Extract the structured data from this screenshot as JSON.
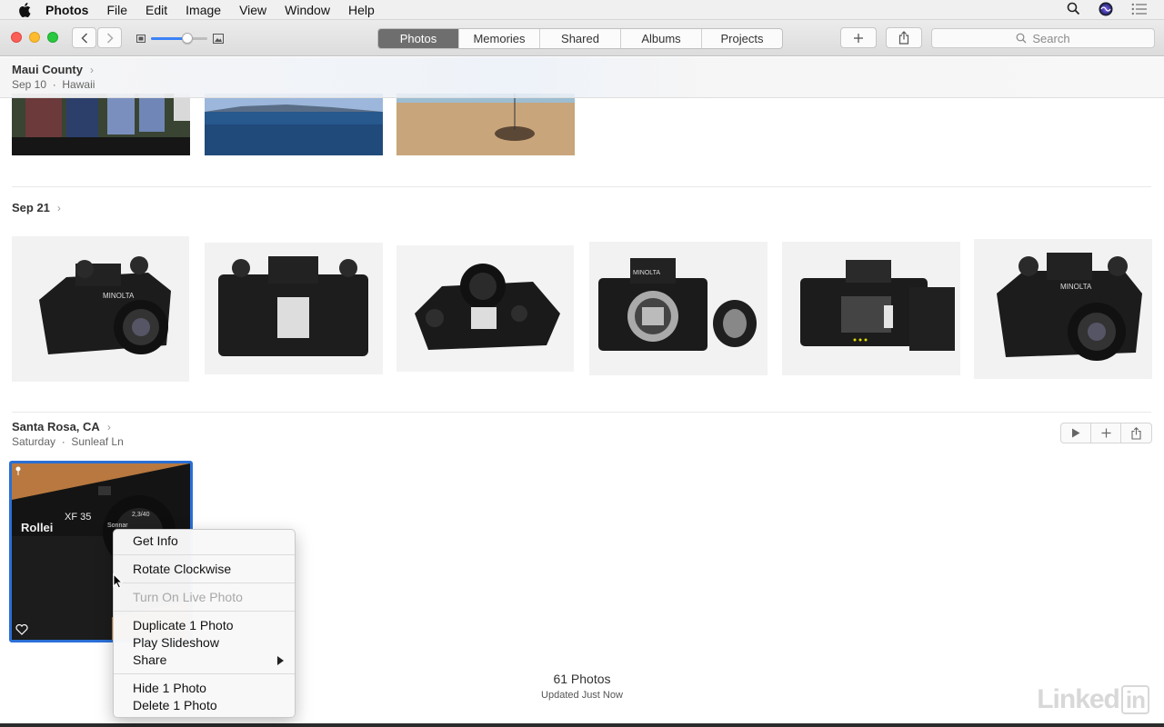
{
  "menubar": {
    "app_name": "Photos",
    "items": [
      "File",
      "Edit",
      "Image",
      "View",
      "Window",
      "Help"
    ],
    "icons": [
      "apple-icon",
      "search-icon",
      "siri-icon",
      "notification-list-icon"
    ]
  },
  "toolbar": {
    "tabs": [
      {
        "label": "Photos",
        "active": true
      },
      {
        "label": "Memories",
        "active": false
      },
      {
        "label": "Shared",
        "active": false
      },
      {
        "label": "Albums",
        "active": false
      },
      {
        "label": "Projects",
        "active": false
      }
    ],
    "zoom_level": 0.65,
    "add_icon": "plus-icon",
    "share_icon": "share-icon",
    "search_placeholder": "Search"
  },
  "sections": [
    {
      "title": "Maui County",
      "subtitle_date": "Sep 10",
      "subtitle_place": "Hawaii"
    },
    {
      "title": "Sep 21"
    },
    {
      "title": "Santa Rosa, CA",
      "subtitle_date": "Saturday",
      "subtitle_place": "Sunleaf Ln"
    }
  ],
  "context_menu": {
    "group1": [
      "Get Info"
    ],
    "group2": [
      "Rotate Clockwise"
    ],
    "group3_disabled": [
      "Turn On Live Photo"
    ],
    "group4": [
      "Duplicate 1 Photo",
      "Play Slideshow",
      "Share"
    ],
    "group5": [
      "Hide 1 Photo",
      "Delete 1 Photo"
    ]
  },
  "footer": {
    "count": "61 Photos",
    "updated": "Updated Just Now"
  },
  "watermark": {
    "text": "Linked",
    "badge": "in"
  },
  "colors": {
    "accent": "#2a6fd6",
    "active_tab": "#6e6e6e"
  }
}
